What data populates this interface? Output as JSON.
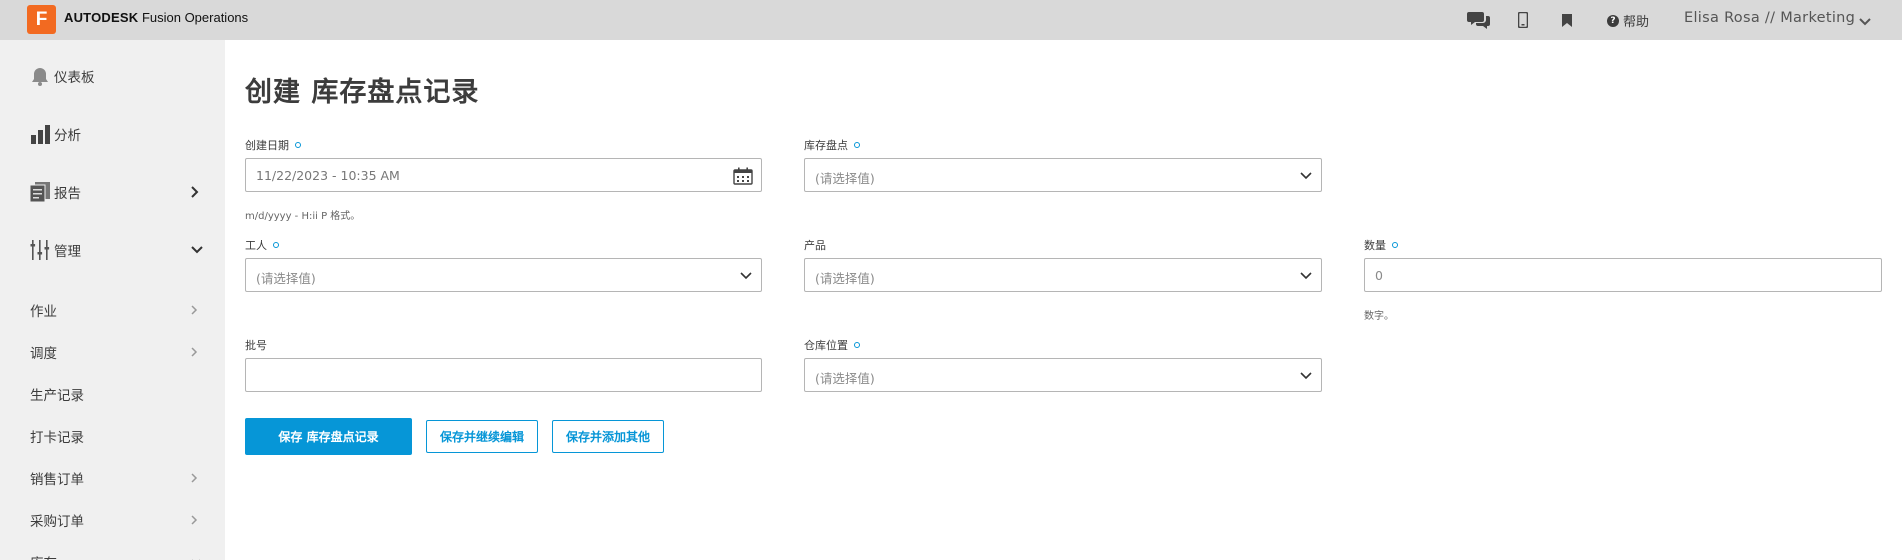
{
  "header": {
    "logo_letter": "F",
    "brand_bold": "AUTODESK",
    "brand_product": "Fusion Operations",
    "help_label": "帮助",
    "user_label": "Elisa Rosa // Marketing",
    "icons": [
      "chat-icon",
      "mobile-icon",
      "bookmark-icon",
      "help-icon",
      "chevron-down-icon"
    ]
  },
  "sidebar": {
    "main_items": [
      {
        "label": "仪表板",
        "icon": "bell-icon"
      },
      {
        "label": "分析",
        "icon": "bar-chart-icon"
      },
      {
        "label": "报告",
        "icon": "report-icon"
      },
      {
        "label": "管理",
        "icon": "sliders-icon"
      }
    ],
    "sub_items": [
      {
        "label": "作业"
      },
      {
        "label": "调度"
      },
      {
        "label": "生产记录"
      },
      {
        "label": "打卡记录"
      },
      {
        "label": "销售订单"
      },
      {
        "label": "采购订单"
      },
      {
        "label": "库存"
      }
    ]
  },
  "page": {
    "title": "创建 库存盘点记录"
  },
  "form": {
    "created_date": {
      "label": "创建日期",
      "value": "11/22/2023 - 10:35 AM",
      "hint": "m/d/yyyy - H:ii P 格式。"
    },
    "inventory_count": {
      "label": "库存盘点",
      "placeholder": "(请选择值)"
    },
    "worker": {
      "label": "工人",
      "placeholder": "(请选择值)"
    },
    "product": {
      "label": "产品",
      "placeholder": "(请选择值)"
    },
    "quantity": {
      "label": "数量",
      "value": "0",
      "hint": "数字。"
    },
    "batch": {
      "label": "批号",
      "value": ""
    },
    "warehouse_location": {
      "label": "仓库位置",
      "placeholder": "(请选择值)"
    }
  },
  "actions": {
    "save": "保存 库存盘点记录",
    "save_continue": "保存并继续编辑",
    "save_add": "保存并添加其他"
  },
  "colors": {
    "accent": "#0696d7",
    "logo": "#f26a21",
    "topbar": "#d9d9d9",
    "sidebar": "#f0f0f0"
  }
}
